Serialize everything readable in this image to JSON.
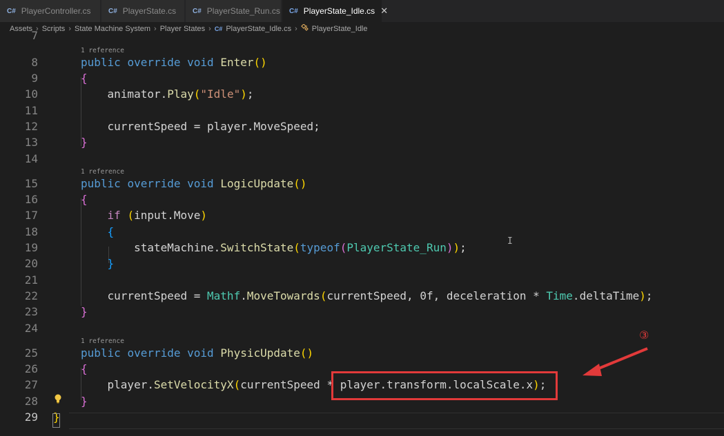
{
  "tabs": [
    {
      "icon": "C#",
      "label": "PlayerController.cs"
    },
    {
      "icon": "C#",
      "label": "PlayerState.cs"
    },
    {
      "icon": "C#",
      "label": "PlayerState_Run.cs"
    },
    {
      "icon": "C#",
      "label": "PlayerState_Idle.cs",
      "close": "✕"
    }
  ],
  "breadcrumb": {
    "sep": "›",
    "items": [
      "Assets",
      "Scripts",
      "State Machine System",
      "Player States"
    ],
    "file_icon": "C#",
    "file": "PlayerState_Idle.cs",
    "class_icon": "class-icon",
    "class_name": "PlayerState_Idle"
  },
  "code": {
    "reference_label": "1 reference",
    "line_numbers": [
      "7",
      "8",
      "9",
      "10",
      "11",
      "12",
      "13",
      "14",
      "15",
      "16",
      "17",
      "18",
      "19",
      "20",
      "21",
      "22",
      "23",
      "24",
      "25",
      "26",
      "27",
      "28",
      "29"
    ],
    "t": {
      "public": "public",
      "override": "override",
      "void": "void",
      "enter": "Enter",
      "logic_update": "LogicUpdate",
      "physic_update": "PhysicUpdate",
      "lp": "(",
      "rp": ")",
      "lb": "{",
      "rb": "}",
      "semi": ";",
      "comma": ",",
      "dot": ".",
      "animator": "animator",
      "play": "Play",
      "idle_str": "\"Idle\"",
      "current_speed": "currentSpeed",
      "eq": " = ",
      "player": "player",
      "move_speed": "MoveSpeed",
      "if": "if",
      "input": "input",
      "move": "Move",
      "state_machine": "stateMachine",
      "switch_state": "SwitchState",
      "typeof": "typeof",
      "player_state_run": "PlayerState_Run",
      "mathf": "Mathf",
      "move_towards": "MoveTowards",
      "zero": "0f",
      "deceleration": "deceleration",
      "times": "*",
      "time": "Time",
      "delta_time": "deltaTime",
      "set_velocity_x": "SetVelocityX",
      "transform": "transform",
      "local_scale": "localScale",
      "x": "x"
    }
  },
  "annotation": {
    "marker": "③",
    "color": "#e23a3a"
  },
  "colors": {
    "keyword": "#569cd6",
    "method": "#dcdcaa",
    "string": "#ce9178",
    "type": "#4ec9b0",
    "control": "#c586c0"
  }
}
